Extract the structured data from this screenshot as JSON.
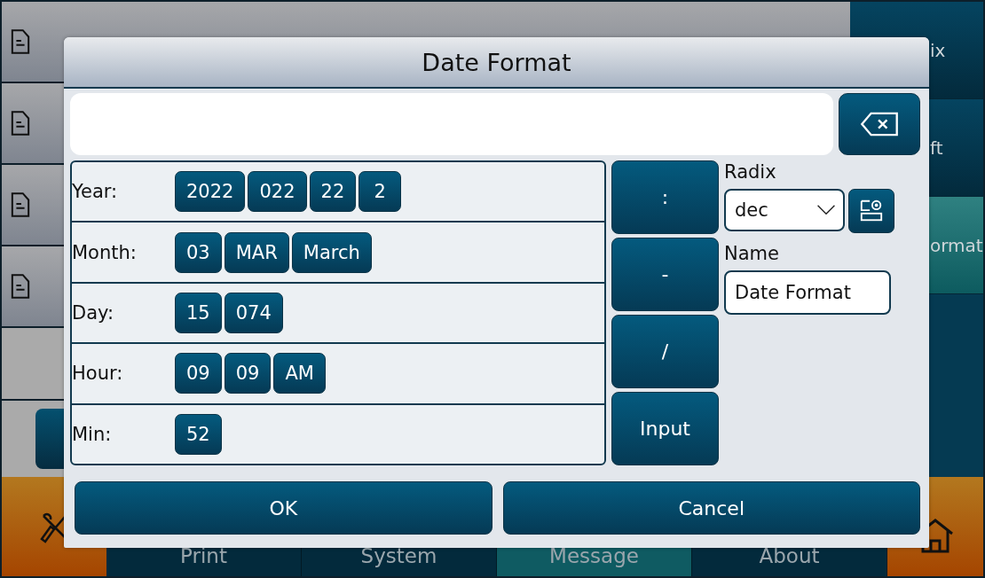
{
  "side_buttons": [
    {
      "label": "ix",
      "selected": false
    },
    {
      "label": "ft",
      "selected": false
    },
    {
      "label": "ormat",
      "selected": true
    }
  ],
  "tabs": [
    {
      "label": "Print",
      "selected": false
    },
    {
      "label": "System",
      "selected": false
    },
    {
      "label": "Message",
      "selected": true
    },
    {
      "label": "About",
      "selected": false
    }
  ],
  "dialog": {
    "title": "Date Format",
    "rows": [
      {
        "label": "Year:",
        "options": [
          "2022",
          "022",
          "22",
          "2"
        ]
      },
      {
        "label": "Month:",
        "options": [
          "03",
          "MAR",
          "March"
        ]
      },
      {
        "label": "Day:",
        "options": [
          "15",
          "074"
        ]
      },
      {
        "label": "Hour:",
        "options": [
          "09",
          "09",
          "AM"
        ]
      },
      {
        "label": "Min:",
        "options": [
          "52"
        ]
      }
    ],
    "symbols": [
      ":",
      "-",
      "/",
      "Input"
    ],
    "radix": {
      "label": "Radix",
      "value": "dec"
    },
    "name": {
      "label": "Name",
      "value": "Date Format"
    },
    "buttons": [
      "OK",
      "Cancel"
    ]
  }
}
